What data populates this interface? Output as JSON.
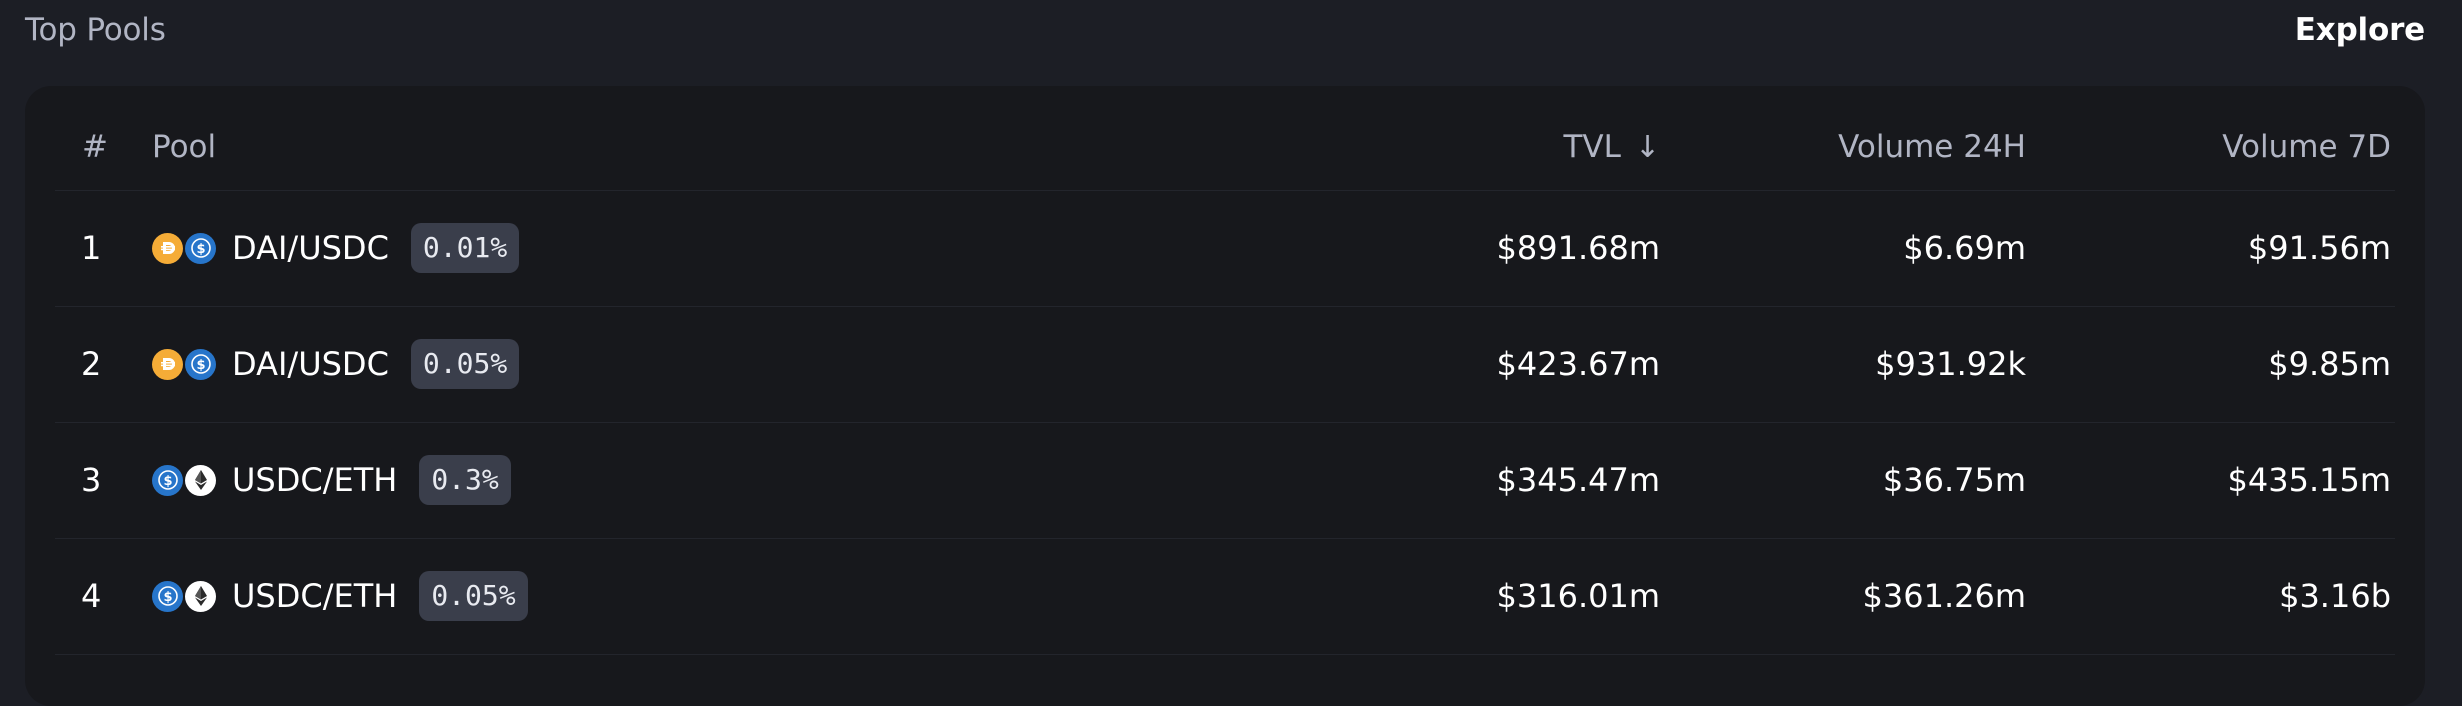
{
  "header": {
    "title": "Top Pools",
    "explore_label": "Explore"
  },
  "table": {
    "columns": {
      "num": "#",
      "pool": "Pool",
      "tvl": "TVL",
      "volume_24h": "Volume 24H",
      "volume_7d": "Volume 7D"
    },
    "sort_icon": "arrow-down-icon",
    "rows": [
      {
        "num": "1",
        "pair": "DAI/USDC",
        "fee": "0.01%",
        "tvl": "$891.68m",
        "volume_24h": "$6.69m",
        "volume_7d": "$91.56m",
        "tokens": [
          "dai",
          "usdc"
        ]
      },
      {
        "num": "2",
        "pair": "DAI/USDC",
        "fee": "0.05%",
        "tvl": "$423.67m",
        "volume_24h": "$931.92k",
        "volume_7d": "$9.85m",
        "tokens": [
          "dai",
          "usdc"
        ]
      },
      {
        "num": "3",
        "pair": "USDC/ETH",
        "fee": "0.3%",
        "tvl": "$345.47m",
        "volume_24h": "$36.75m",
        "volume_7d": "$435.15m",
        "tokens": [
          "usdc",
          "eth"
        ]
      },
      {
        "num": "4",
        "pair": "USDC/ETH",
        "fee": "0.05%",
        "tvl": "$316.01m",
        "volume_24h": "$361.26m",
        "volume_7d": "$3.16b",
        "tokens": [
          "usdc",
          "eth"
        ]
      }
    ]
  },
  "colors": {
    "background": "#1c1e25",
    "card": "#17181c",
    "muted_text": "#b1b5c4",
    "badge": "#3a3e4b",
    "dai": "#f5ac37",
    "usdc": "#2775ca",
    "eth": "#ffffff"
  }
}
